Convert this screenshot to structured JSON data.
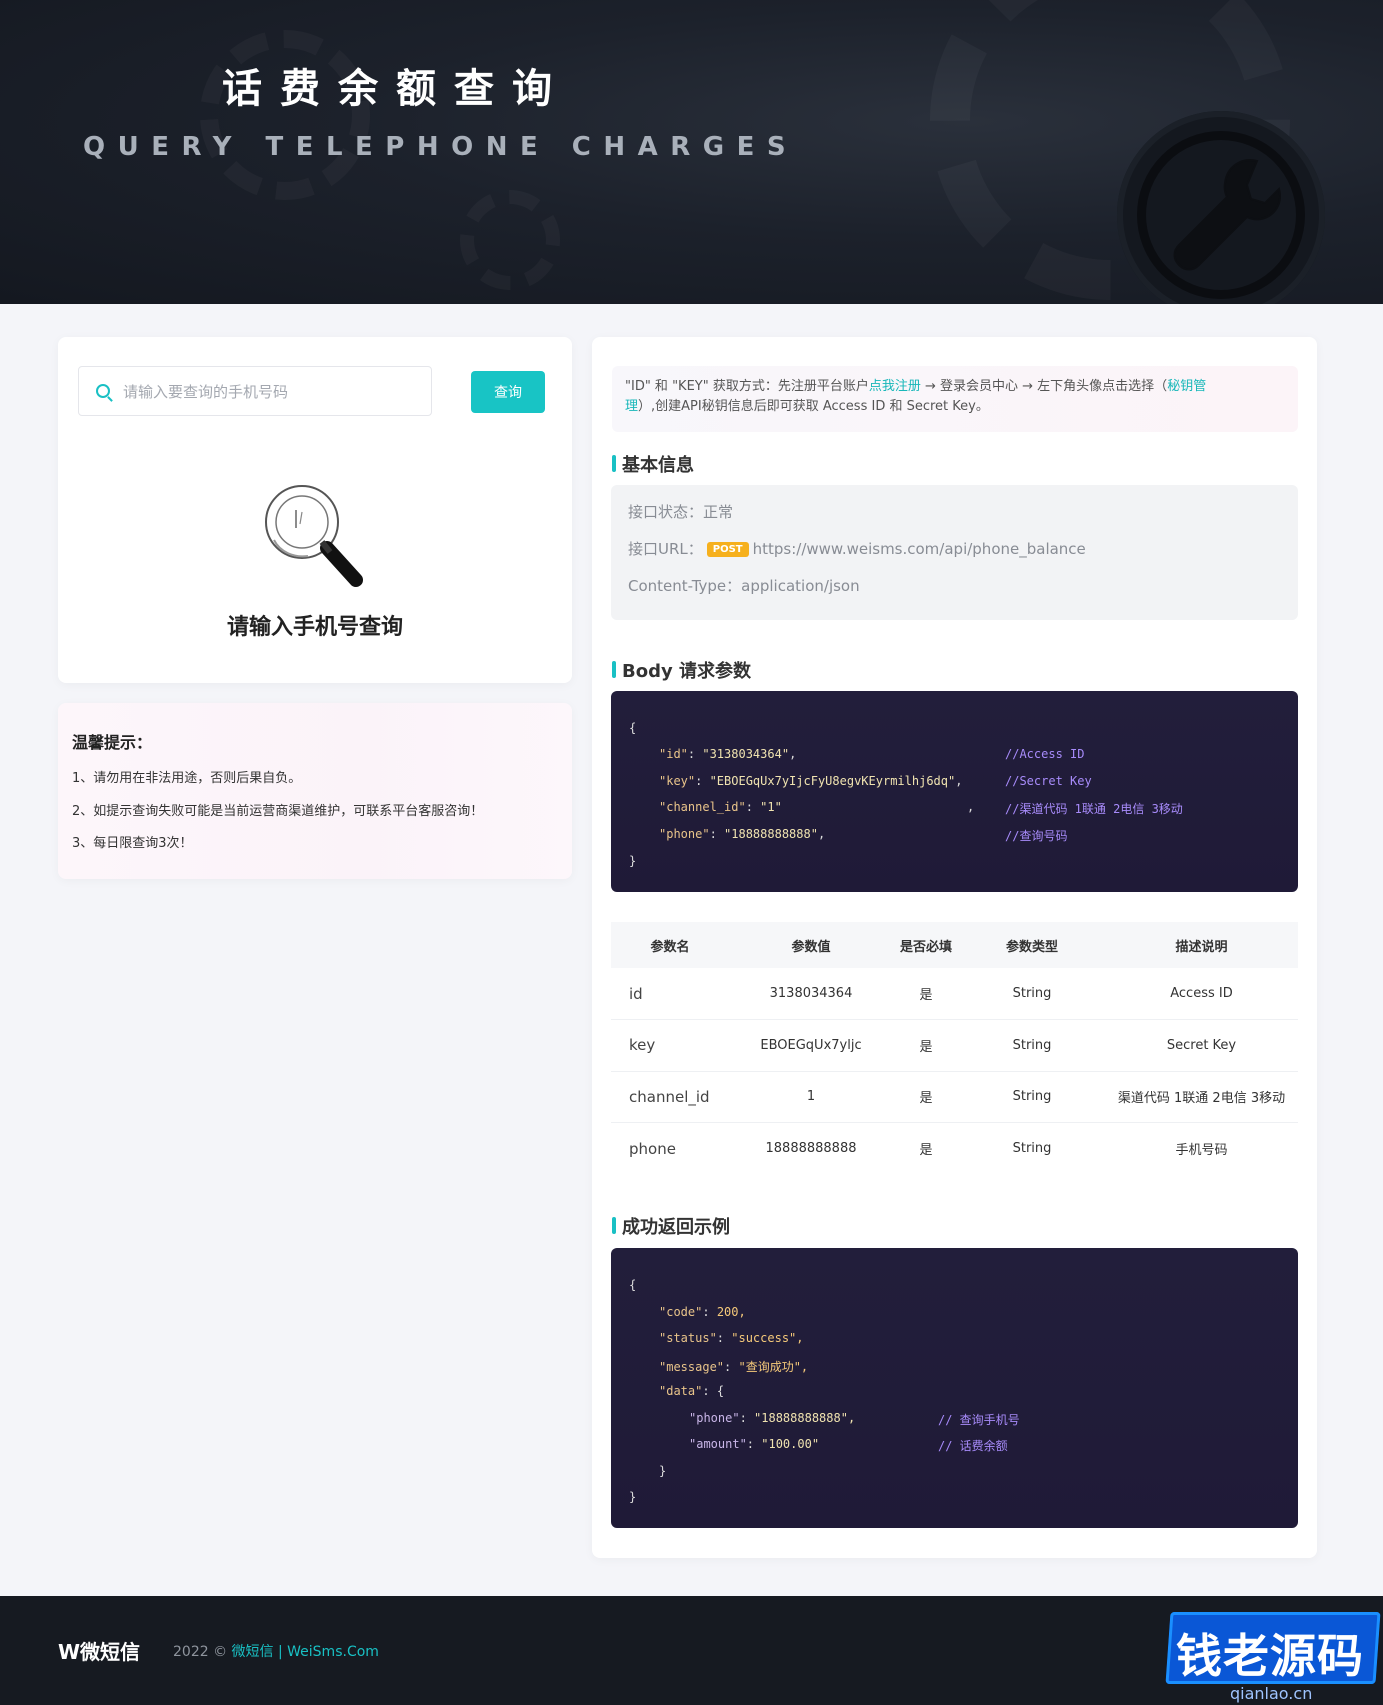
{
  "banner": {
    "title": "话费余额查询",
    "subtitle": "QUERY TELEPHONE CHARGES",
    "icon": "wrench-icon"
  },
  "search": {
    "placeholder": "请输入要查询的手机号码",
    "value": "",
    "button_label": "查询",
    "empty_hint": "请输入手机号查询"
  },
  "tips": {
    "title": "温馨提示：",
    "items": [
      "1、请勿用在非法用途，否则后果自负。",
      "2、如提示查询失败可能是当前运营商渠道维护，可联系平台客服咨询！",
      "3、每日限查询3次！"
    ]
  },
  "notice": {
    "prefix": "\"ID\" 和 \"KEY\" 获取方式：先注册平台账户",
    "register_link": "点我注册",
    "middle": " → 登录会员中心 → 左下角头像点击选择（",
    "key_link_1": "秘钥管",
    "key_link_2": "理",
    "suffix": "）,创建API秘钥信息后即可获取 Access ID 和 Secret Key。"
  },
  "basic": {
    "title": "基本信息",
    "status_label": "接口状态：",
    "status_value": "正常",
    "url_label": "接口URL：",
    "method": "POST",
    "url": "https://www.weisms.com/api/phone_balance",
    "content_type_label": "Content-Type：",
    "content_type": "application/json"
  },
  "body_params": {
    "title": "Body 请求参数",
    "open": "{",
    "close": "}",
    "lines": [
      {
        "key": "\"id\"",
        "value": "\"3138034364\"",
        "tail": ",",
        "comment": "//Access ID"
      },
      {
        "key": "\"key\"",
        "value": "\"EBOEGqUx7yIjcFyU8egvKEyrmilhj6dq\"",
        "tail": ",",
        "comment": "//Secret Key"
      },
      {
        "key": "\"channel_id\"",
        "value": "\"1\"",
        "tail": ",",
        "comment": "//渠道代码 1联通 2电信 3移动"
      },
      {
        "key": "\"phone\"",
        "value": "\"18888888888\"",
        "tail": ",",
        "comment": "//查询号码"
      }
    ]
  },
  "table": {
    "headers": [
      "参数名",
      "参数值",
      "是否必填",
      "参数类型",
      "描述说明"
    ],
    "rows": [
      [
        "id",
        "3138034364",
        "是",
        "String",
        "Access ID"
      ],
      [
        "key",
        "EBOEGqUx7yljc",
        "是",
        "String",
        "Secret Key"
      ],
      [
        "channel_id",
        "1",
        "是",
        "String",
        "渠道代码 1联通 2电信 3移动"
      ],
      [
        "phone",
        "18888888888",
        "是",
        "String",
        "手机号码"
      ]
    ]
  },
  "response": {
    "title": "成功返回示例",
    "open": "{",
    "code_key": "\"code\"",
    "code_value": "200,",
    "status_key": "\"status\"",
    "status_value": "\"success\",",
    "message_key": "\"message\"",
    "message_value": "\"查询成功\",",
    "data_key": "\"data\"",
    "data_open": "{",
    "phone_key": "\"phone\"",
    "phone_value": "\"18888888888\",",
    "phone_comment": "// 查询手机号",
    "amount_key": "\"amount\"",
    "amount_value": "\"100.00\"",
    "amount_comment": "// 话费余额",
    "data_close": "}",
    "close": "}"
  },
  "footer": {
    "logo": "W微短信",
    "year": "2022 © ",
    "brand": "微短信 | WeiSms.Com"
  },
  "watermark": {
    "text": "钱老源码",
    "url": "qianlao.cn"
  },
  "colors": {
    "accent": "#19c0c4",
    "post_badge": "#f6b01d",
    "code_bg": "#221e3b",
    "banner_bg": "#1c212b"
  }
}
